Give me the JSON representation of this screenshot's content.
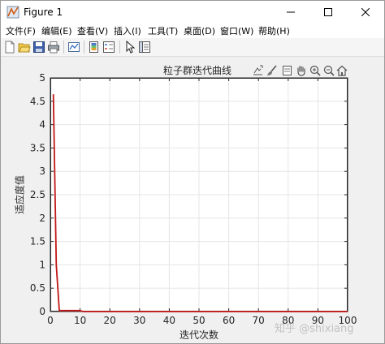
{
  "window": {
    "title": "Figure 1",
    "icons": {
      "app": "matlab-figure-icon",
      "minimize": "minimize-icon",
      "maximize": "maximize-icon",
      "close": "close-icon"
    }
  },
  "menu": {
    "items": [
      {
        "label": "文件(F)"
      },
      {
        "label": "编辑(E)"
      },
      {
        "label": "查看(V)"
      },
      {
        "label": "插入(I)"
      },
      {
        "label": "工具(T)"
      },
      {
        "label": "桌面(D)"
      },
      {
        "label": "窗口(W)"
      },
      {
        "label": "帮助(H)"
      }
    ]
  },
  "toolbar": {
    "icons": [
      "new-figure-icon",
      "open-file-icon",
      "save-icon",
      "print-icon",
      "link-plot-icon",
      "insert-colorbar-icon",
      "insert-legend-icon",
      "edit-plot-cursor-icon",
      "property-inspector-icon"
    ]
  },
  "axes_toolbar": {
    "icons": [
      "export-icon",
      "brush-icon",
      "datatip-icon",
      "pan-hand-icon",
      "zoom-in-icon",
      "zoom-out-icon",
      "home-restore-icon"
    ]
  },
  "watermark": "知乎 @shixiang",
  "colors": {
    "line": "#c01818",
    "grid": "#e6e6e6",
    "axis": "#262626",
    "background": "#f0f0f0"
  },
  "chart_data": {
    "type": "line",
    "title": "粒子群迭代曲线",
    "xlabel": "迭代次数",
    "ylabel": "适应度值",
    "xlim": [
      0,
      100
    ],
    "ylim": [
      0,
      5
    ],
    "grid": true,
    "xticks": [
      0,
      10,
      20,
      30,
      40,
      50,
      60,
      70,
      80,
      90,
      100
    ],
    "yticks": [
      0,
      0.5,
      1,
      1.5,
      2,
      2.5,
      3,
      3.5,
      4,
      4.5,
      5
    ],
    "xtick_labels": [
      "0",
      "10",
      "20",
      "30",
      "40",
      "50",
      "60",
      "70",
      "80",
      "90",
      "100"
    ],
    "ytick_labels": [
      "0",
      "0.5",
      "1",
      "1.5",
      "2",
      "2.5",
      "3",
      "3.5",
      "4",
      "4.5",
      "5"
    ],
    "series": [
      {
        "x": [
          1,
          2,
          3,
          4,
          5,
          6,
          7,
          8,
          9,
          10,
          11,
          15,
          20,
          30,
          40,
          50,
          60,
          70,
          80,
          90,
          100
        ],
        "values": [
          4.65,
          1.0,
          0.02,
          0.02,
          0.02,
          0.02,
          0.02,
          0.02,
          0.02,
          0.02,
          0.0,
          0.0,
          0.0,
          0.0,
          0.0,
          0.0,
          0.0,
          0.0,
          0.0,
          0.0,
          0.0
        ]
      }
    ]
  }
}
